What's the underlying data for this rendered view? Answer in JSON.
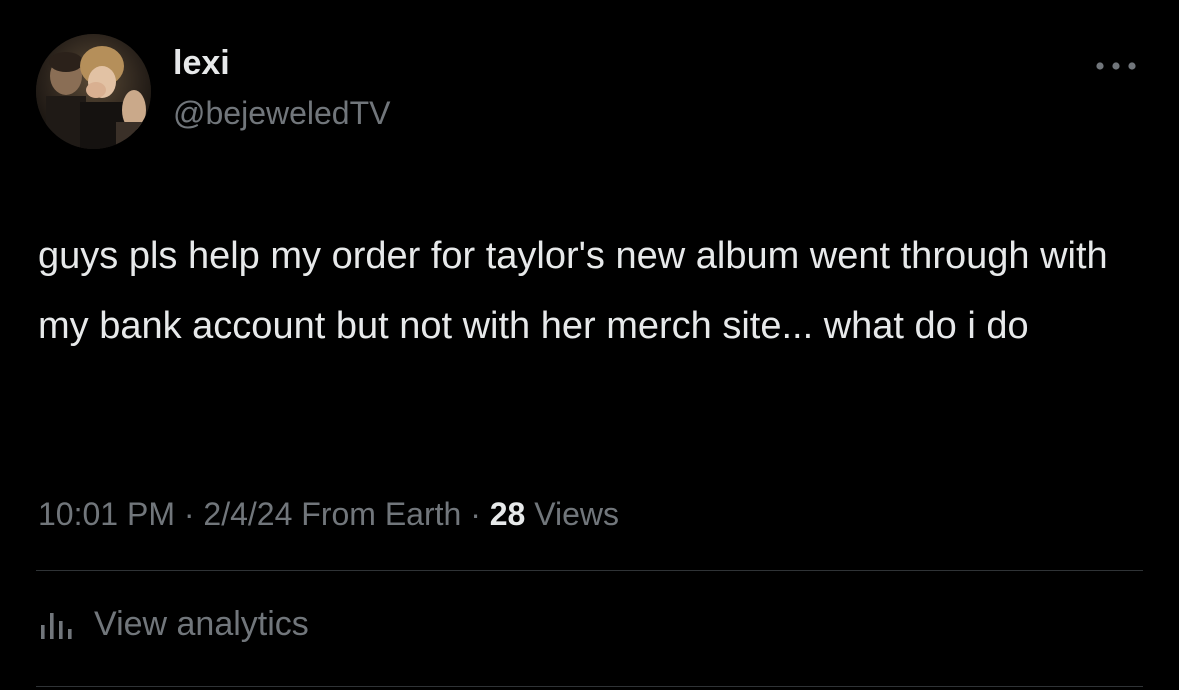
{
  "user": {
    "display_name": "lexi",
    "handle": "@bejeweledTV"
  },
  "tweet": {
    "text": "guys pls help my order for taylor's new album went through with my bank account but not with her merch site... what do i do"
  },
  "meta": {
    "time": "10:01 PM",
    "separator": "·",
    "date": "2/4/24",
    "source": "From Earth",
    "views_count": "28",
    "views_label": "Views"
  },
  "actions": {
    "view_analytics": "View analytics"
  },
  "icons": {
    "more": "more-horizontal-icon",
    "analytics": "bar-chart-icon"
  },
  "colors": {
    "background": "#000000",
    "primary_text": "#e7e9ea",
    "secondary_text": "#71767b",
    "divider": "#2f3336"
  }
}
